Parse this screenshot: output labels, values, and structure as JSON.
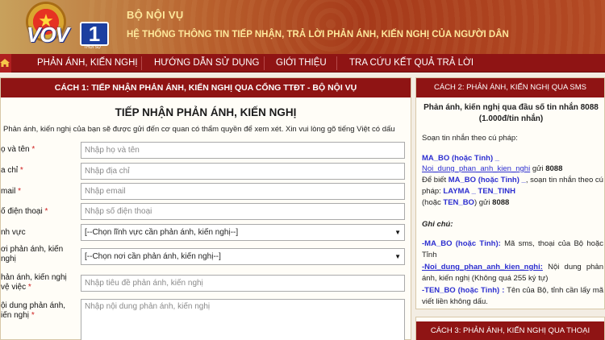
{
  "header": {
    "emblem_letters": "VOV",
    "badge_number": "1",
    "badge_sub": "THỜI SỰ",
    "title": "BỘ NỘI VỤ",
    "subtitle": "HỆ THỐNG THÔNG TIN TIẾP NHẬN, TRẢ LỜI PHẢN ÁNH, KIẾN NGHỊ CỦA NGƯỜI DÂN"
  },
  "nav": {
    "items": [
      {
        "label": "PHẢN ÁNH, KIẾN NGHỊ"
      },
      {
        "label": "HƯỚNG DẪN SỬ DỤNG"
      },
      {
        "label": "GIỚI THIỆU"
      },
      {
        "label": "TRA CỨU KẾT QUẢ TRẢ LỜI"
      }
    ]
  },
  "left": {
    "header": "CÁCH 1: TIẾP NHẬN PHẢN ÁNH, KIẾN NGHỊ QUA CỔNG TTĐT - BỘ NỘI VỤ",
    "form_title": "TIẾP NHẬN PHẢN ÁNH, KIẾN NGHỊ",
    "description": "Phản ánh, kiến nghị của bạn sẽ được gửi đến cơ quan có thẩm quyền để xem xét. Xin vui lòng gõ tiếng Việt có dấu",
    "fields": {
      "name": {
        "label": "ọ và tên",
        "placeholder": "Nhập họ và tên"
      },
      "address": {
        "label": "a chỉ",
        "placeholder": "Nhập địa chỉ"
      },
      "email": {
        "label": "mail",
        "placeholder": "Nhập email"
      },
      "phone": {
        "label": "ố điện thoại",
        "placeholder": "Nhập số điện thoại"
      },
      "field": {
        "label": "nh vực",
        "value": "[--Chọn lĩnh vực cần phản ánh, kiến nghị--]"
      },
      "place": {
        "label1": "ơi phản ánh, kiến",
        "label2": "nghị",
        "value": "[--Chọn nơi cần phản ánh, kiến nghị--]"
      },
      "subject": {
        "label1": "hản ánh, kiến nghị",
        "label2": "vệ việc",
        "placeholder": "Nhập tiêu đề phản ánh, kiến nghị"
      },
      "content": {
        "label1": "ội dung phản ánh,",
        "label2": "iến nghị",
        "placeholder": "Nhập nội dung phản ánh, kiến nghị"
      }
    }
  },
  "right": {
    "sms_header": "CÁCH 2: PHẢN ÁNH, KIẾN NGHỊ QUA SMS",
    "sms_intro_1": "Phản ánh, kiến nghị qua đầu số tin nhắn 8088",
    "sms_intro_2": "(1.000đ/tin nhắn)",
    "compose": "Soạn tin nhắn theo cú pháp:",
    "code": "MA_BO (hoặc Tỉnh) _",
    "content_code": "Noi_dung_phan_anh_kien_nghi",
    "send_to": "gửi",
    "number": "8088",
    "to_know": "Để biết",
    "to_know_rest": ", soạn tin nhắn theo cú",
    "syntax": "pháp:",
    "layma": "LAYMA _ TEN_TINH",
    "or_tenbo": "TEN_BO",
    "or_open": "(hoặc",
    "or_close": ") gửi",
    "note_title": "Ghi chú:",
    "note1_code": "-MA_BO (hoặc Tỉnh):",
    "note1_text": " Mã sms, thoại của Bộ hoặc Tỉnh",
    "note2_code": "-Noi_dung_phan_anh_kien_nghi:",
    "note2_text": " Nội dung phản ánh, kiến nghị (Không quá 255 ký tự)",
    "note3_code": "-TEN_BO (hoặc Tỉnh) :",
    "note3_text": " Tên của Bộ, tỉnh cần lấy mã viết liền không dấu.",
    "phone_header": "CÁCH 3: PHẢN ÁNH, KIẾN NGHỊ QUA THOẠI"
  },
  "colors": {
    "nav": "#8f1414",
    "header_text": "#fde79b",
    "code_blue": "#2c2ed0",
    "required": "#d02020"
  }
}
